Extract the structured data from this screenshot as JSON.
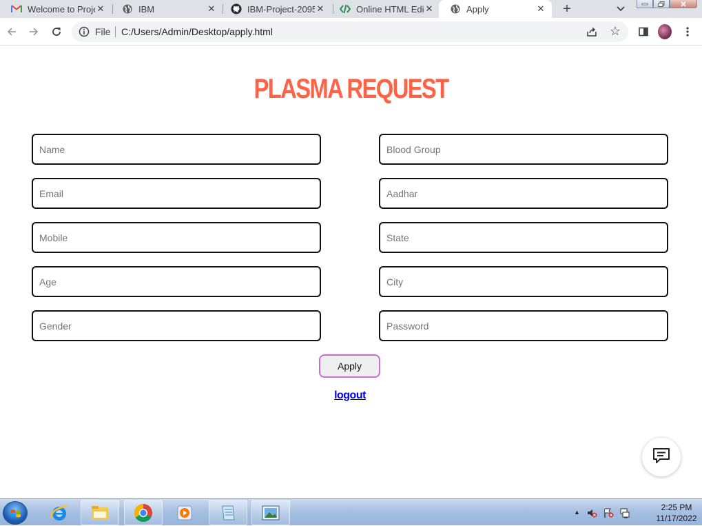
{
  "browser": {
    "tabs": [
      {
        "title": "Welcome to Proje",
        "icon": "gmail-icon",
        "active": false
      },
      {
        "title": "IBM",
        "icon": "globe-icon",
        "active": false
      },
      {
        "title": "IBM-Project-2095",
        "icon": "github-icon",
        "active": false
      },
      {
        "title": "Online HTML Edit",
        "icon": "code-icon",
        "active": false
      },
      {
        "title": "Apply",
        "icon": "globe-icon",
        "active": true
      }
    ],
    "close_glyph": "✕",
    "newtab_glyph": "+",
    "address": {
      "scheme": "File",
      "url": "C:/Users/Admin/Desktop/apply.html"
    }
  },
  "page": {
    "title": "PLASMA REQUEST",
    "title_color": "#ff6347",
    "form": {
      "left_fields": [
        {
          "placeholder": "Name",
          "value": ""
        },
        {
          "placeholder": "Email",
          "value": ""
        },
        {
          "placeholder": "Mobile",
          "value": ""
        },
        {
          "placeholder": "Age",
          "value": ""
        },
        {
          "placeholder": "Gender",
          "value": ""
        }
      ],
      "right_fields": [
        {
          "placeholder": "Blood Group",
          "value": ""
        },
        {
          "placeholder": "Aadhar",
          "value": ""
        },
        {
          "placeholder": "State",
          "value": ""
        },
        {
          "placeholder": "City",
          "value": ""
        },
        {
          "placeholder": "Password",
          "value": ""
        }
      ],
      "submit_label": "Apply"
    },
    "logout_label": "logout",
    "chat_icon": "chat-bubble-icon"
  },
  "taskbar": {
    "apps": [
      "internet-explorer-icon",
      "file-explorer-icon",
      "chrome-icon",
      "media-player-icon",
      "notepad-icon",
      "image-viewer-icon"
    ],
    "clock": {
      "time": "2:25 PM",
      "date": "11/17/2022"
    }
  }
}
